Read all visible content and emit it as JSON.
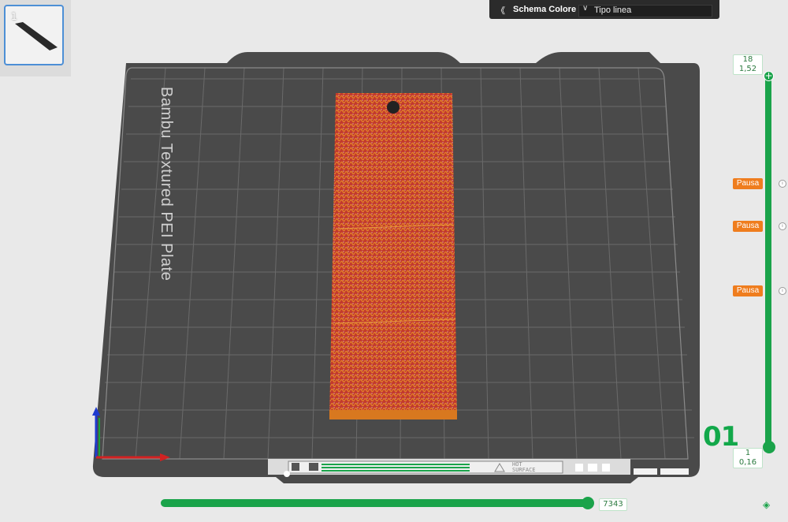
{
  "plate": {
    "thumbnail_number": "1",
    "label": "Bambu Textured PEI Plate",
    "hot_surface_label": "HOT\nSURFACE",
    "big_layer_number": "01"
  },
  "color_scheme_panel": {
    "title": "Schema Colore",
    "selected_value": "Tipo linea",
    "collapse_icon": "double-chevron-down-icon",
    "dropdown_icon": "chevron-down-icon"
  },
  "layer_slider": {
    "top_layer": "18",
    "top_height": "1,52",
    "bottom_layer": "1",
    "bottom_height": "0,16",
    "pauses": [
      "Pausa",
      "Pausa",
      "Pausa"
    ]
  },
  "move_slider": {
    "value": "7343"
  },
  "colors": {
    "accent_green": "#1aa34a",
    "pause_orange": "#ef7d1e",
    "plate_dark": "#4a4a4a",
    "model_red": "#c0352b",
    "model_orange": "#d8781f"
  },
  "icons": {
    "bottom_right": "layers-icon"
  }
}
